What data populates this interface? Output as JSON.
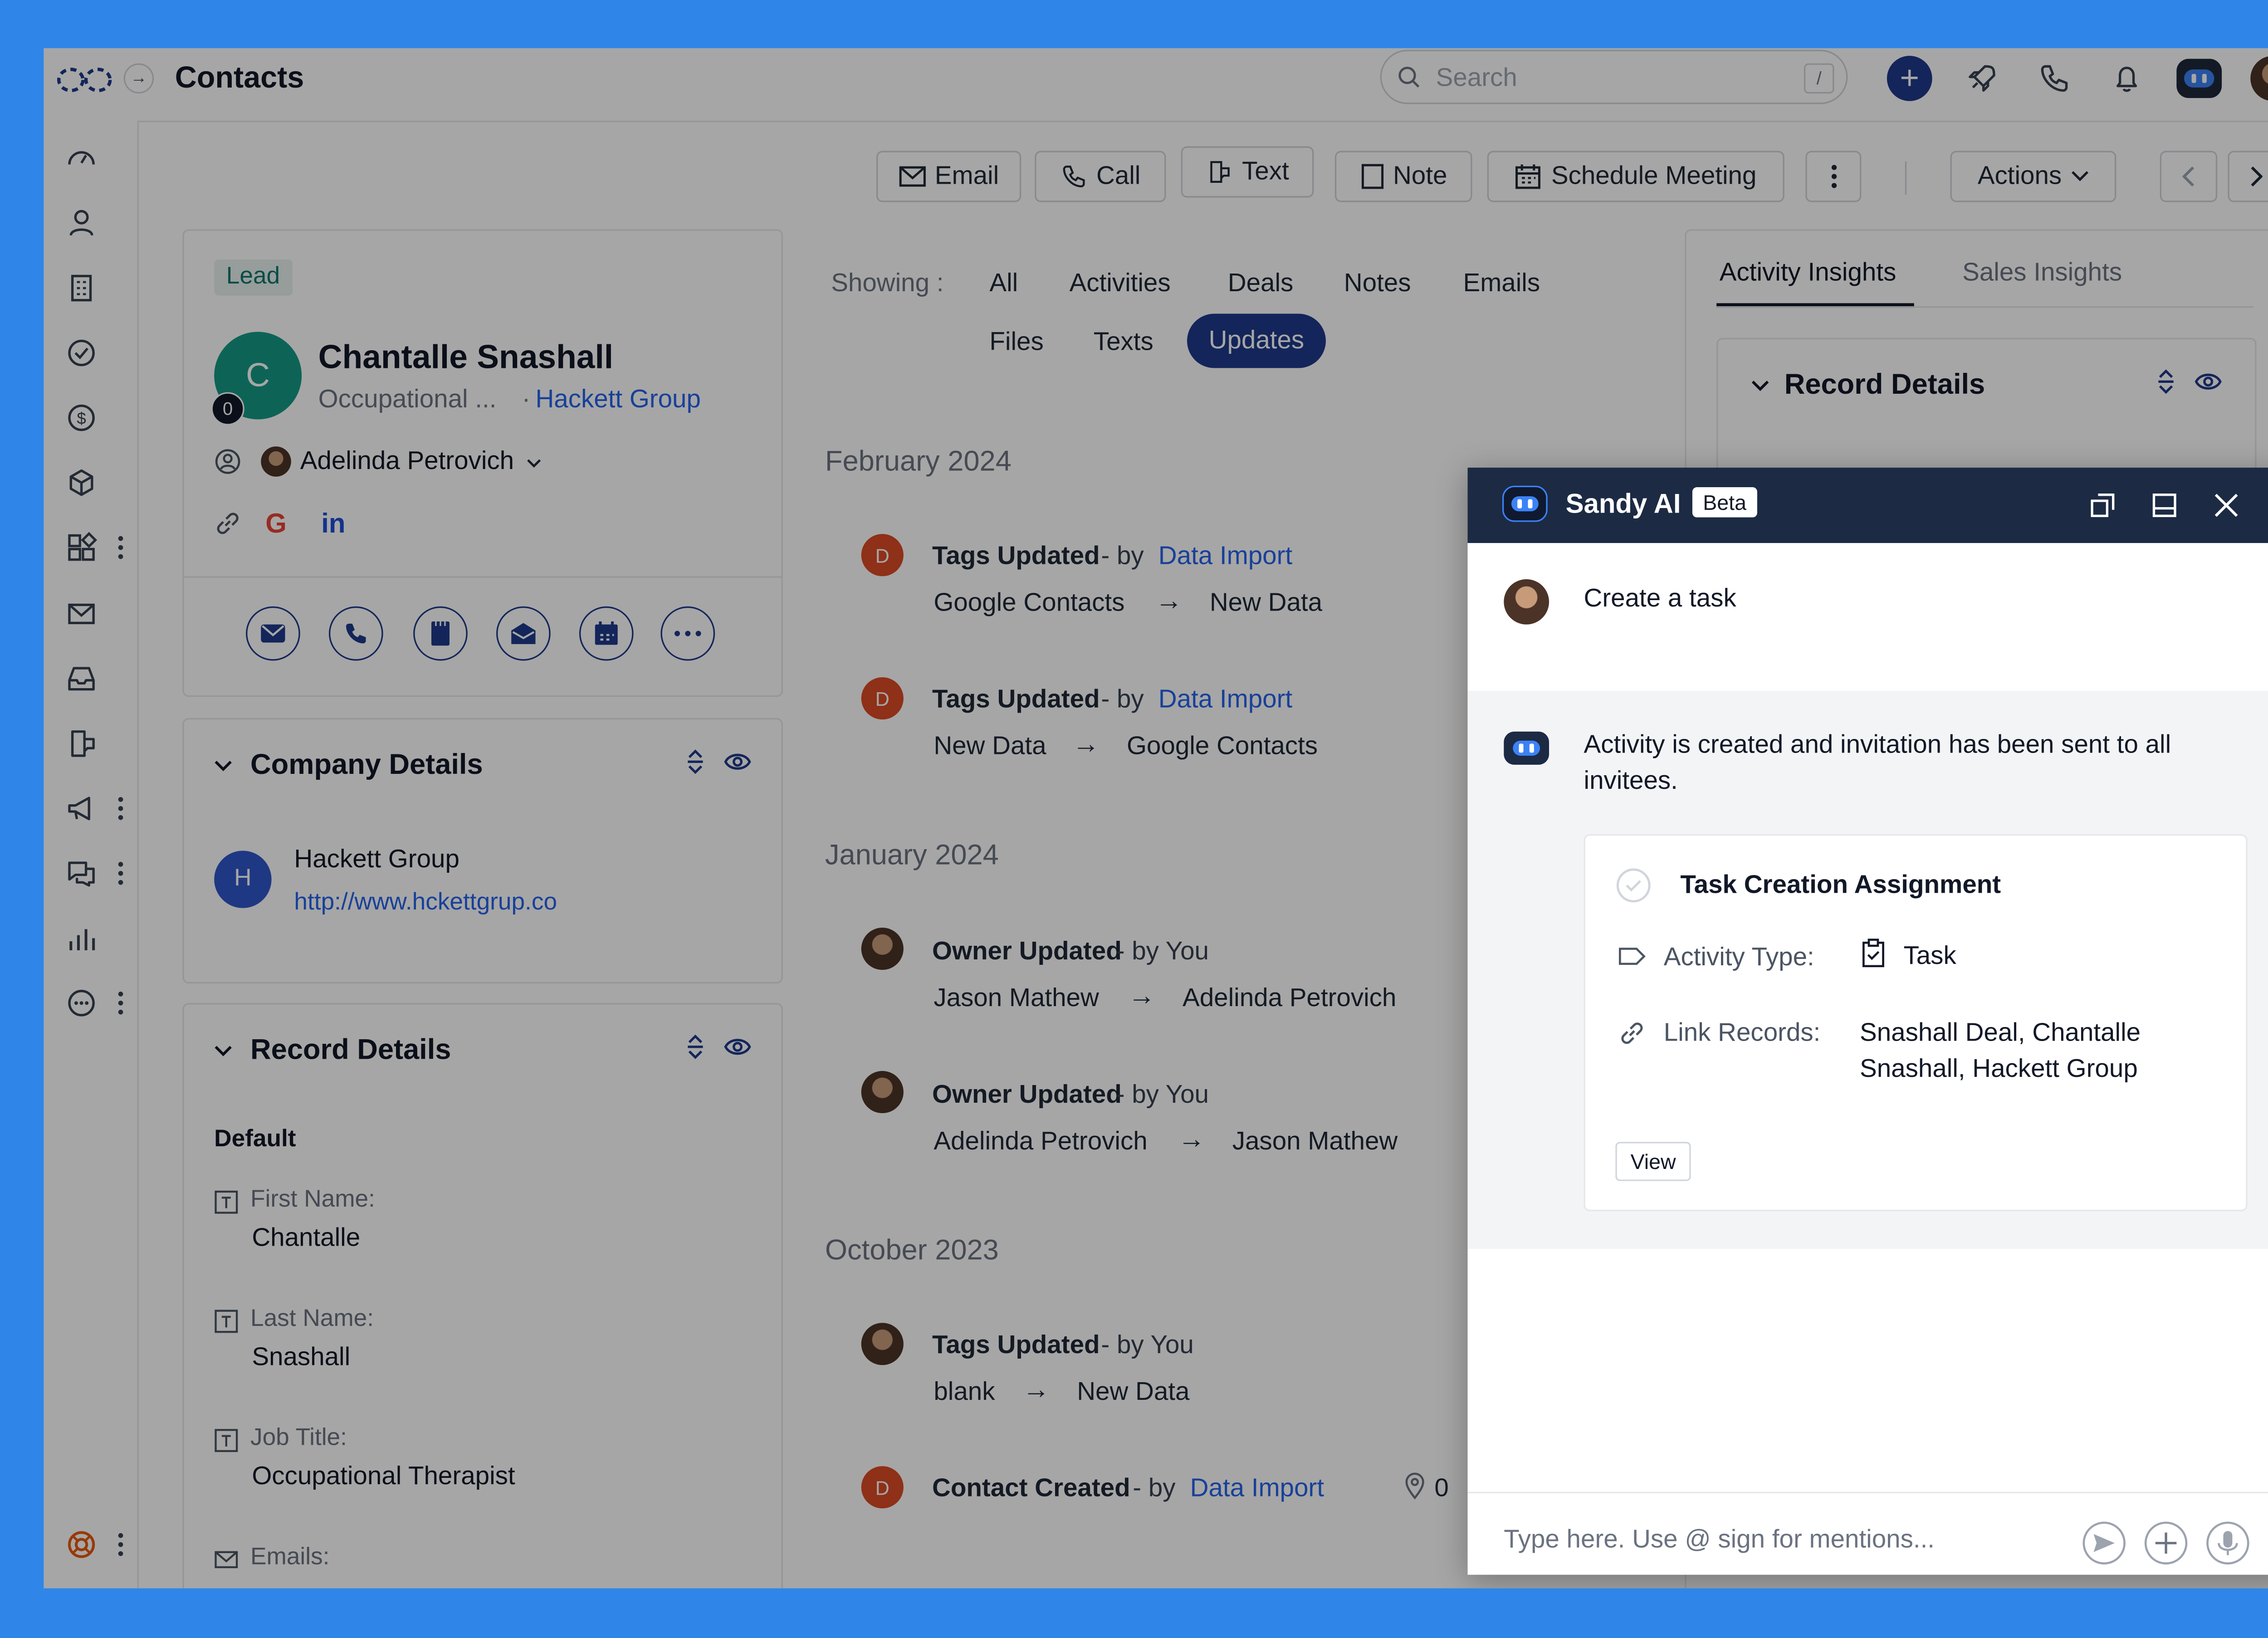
{
  "app": {
    "page_title": "Contacts"
  },
  "topbar": {
    "search_placeholder": "Search",
    "search_shortcut": "/"
  },
  "toolbar": {
    "email": "Email",
    "call": "Call",
    "text": "Text",
    "note": "Note",
    "schedule": "Schedule Meeting",
    "actions": "Actions"
  },
  "contact": {
    "badge": "Lead",
    "initial": "C",
    "name": "Chantalle Snashall",
    "title": "Occupational ...",
    "company_sep": "·",
    "company": "Hackett Group",
    "score": "0",
    "owner": "Adelinda Petrovich"
  },
  "company_details": {
    "heading": "Company Details",
    "initial": "H",
    "name": "Hackett Group",
    "url": "http://www.hckettgrup.co"
  },
  "record_details": {
    "heading": "Record Details",
    "group": "Default",
    "fields": [
      {
        "label": "First Name:",
        "value": "Chantalle"
      },
      {
        "label": "Last Name:",
        "value": "Snashall"
      },
      {
        "label": "Job Title:",
        "value": "Occupational Therapist"
      },
      {
        "label": "Emails:",
        "value": ""
      }
    ]
  },
  "filters": {
    "label": "Showing :",
    "items": [
      "All",
      "Activities",
      "Deals",
      "Notes",
      "Emails",
      "Files",
      "Texts",
      "Updates"
    ],
    "active": "Updates"
  },
  "timeline": {
    "groups": [
      {
        "month": "February 2024"
      },
      {
        "month": "January 2024"
      },
      {
        "month": "October 2023"
      }
    ],
    "items": [
      {
        "initial": "D",
        "title": "Tags Updated",
        "by": "- by",
        "actor": "Data Import",
        "from": "Google Contacts",
        "arrow": "→",
        "to": "New Data"
      },
      {
        "initial": "D",
        "title": "Tags Updated",
        "by": "- by",
        "actor": "Data Import",
        "from": "New Data",
        "arrow": "→",
        "to": "Google Contacts"
      },
      {
        "title": "Owner Updated",
        "by": "- by You",
        "from": "Jason Mathew",
        "arrow": "→",
        "to": "Adelinda Petrovich"
      },
      {
        "title": "Owner Updated",
        "by": "- by You",
        "from": "Adelinda Petrovich",
        "arrow": "→",
        "to": "Jason Mathew"
      },
      {
        "title": "Tags Updated",
        "by": "- by You",
        "from": "blank",
        "arrow": "→",
        "to": "New Data"
      },
      {
        "initial": "D",
        "title": "Contact Created",
        "by": "- by",
        "actor": "Data Import",
        "pin_count": "0"
      }
    ]
  },
  "insights": {
    "tabs": [
      "Activity Insights",
      "Sales Insights"
    ],
    "active": "Activity Insights",
    "record_details": "Record Details"
  },
  "chat": {
    "title": "Sandy AI",
    "badge": "Beta",
    "user_message": "Create a task",
    "bot_message": "Activity is created and invitation has been sent to all invitees.",
    "card": {
      "title": "Task Creation Assignment",
      "activity_type_label": "Activity Type:",
      "activity_type_value": "Task",
      "link_records_label": "Link Records:",
      "link_records_value": "Snashall Deal, Chantalle Snashall, Hackett Group",
      "view_button": "View"
    },
    "input_placeholder": "Type here. Use @ sign for mentions..."
  },
  "colors": {
    "background": "#2f86e8",
    "accent": "#1e3a8a",
    "link": "#2563eb",
    "lead_badge": "#0f766e",
    "overlay": "rgba(0,0,0,0.35)"
  }
}
